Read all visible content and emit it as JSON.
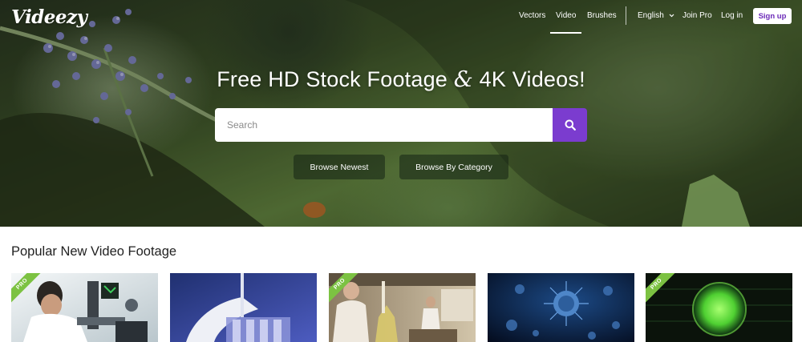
{
  "brand": {
    "logo": "Videezy"
  },
  "nav": {
    "items": [
      {
        "label": "Vectors",
        "active": false
      },
      {
        "label": "Video",
        "active": true
      },
      {
        "label": "Brushes",
        "active": false
      }
    ],
    "language": "English",
    "join_pro": "Join Pro",
    "login": "Log in",
    "signup": "Sign up"
  },
  "hero": {
    "title_part1": "Free HD Stock Footage ",
    "title_amp": "&",
    "title_part2": " 4K Videos!",
    "search_placeholder": "Search",
    "browse_newest": "Browse Newest",
    "browse_category": "Browse By Category"
  },
  "section": {
    "title": "Popular New Video Footage",
    "thumbnails": [
      {
        "subject": "scientist at microscope",
        "pro_label": "PRO",
        "pro": true
      },
      {
        "subject": "lab test tubes",
        "pro": false
      },
      {
        "subject": "laboratory workers",
        "pro_label": "PRO",
        "pro": true
      },
      {
        "subject": "blue virus",
        "pro": false
      },
      {
        "subject": "green virus cell",
        "pro_label": "PRO",
        "pro": true
      }
    ]
  },
  "colors": {
    "accent": "#7b3ccf",
    "pro_green": "#7cc242"
  }
}
